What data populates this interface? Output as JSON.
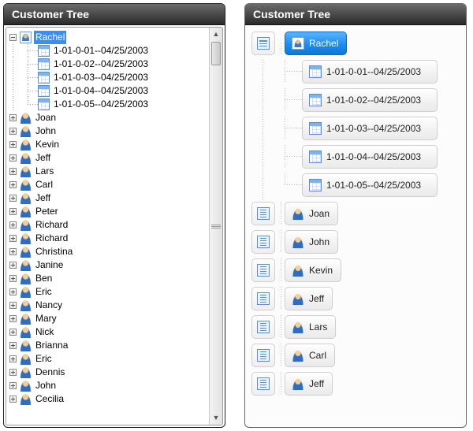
{
  "left": {
    "title": "Customer Tree",
    "root": {
      "label": "Rachel",
      "expanded": true,
      "selected": true,
      "icon": "org",
      "children": [
        {
          "label": "1-01-0-01--04/25/2003",
          "icon": "grid"
        },
        {
          "label": "1-01-0-02--04/25/2003",
          "icon": "grid"
        },
        {
          "label": "1-01-0-03--04/25/2003",
          "icon": "grid"
        },
        {
          "label": "1-01-0-04--04/25/2003",
          "icon": "grid"
        },
        {
          "label": "1-01-0-05--04/25/2003",
          "icon": "grid"
        }
      ]
    },
    "siblings": [
      "Joan",
      "John",
      "Kevin",
      "Jeff",
      "Lars",
      "Carl",
      "Jeff",
      "Peter",
      "Richard",
      "Richard",
      "Christina",
      "Janine",
      "Ben",
      "Eric",
      "Nancy",
      "Mary",
      "Nick",
      "Brianna",
      "Eric",
      "Dennis",
      "John",
      "Cecilia"
    ]
  },
  "right": {
    "title": "Customer Tree",
    "root": {
      "label": "Rachel",
      "expanded": true,
      "selected": true,
      "icon": "org",
      "children": [
        {
          "label": "1-01-0-01--04/25/2003",
          "icon": "grid"
        },
        {
          "label": "1-01-0-02--04/25/2003",
          "icon": "grid"
        },
        {
          "label": "1-01-0-03--04/25/2003",
          "icon": "grid"
        },
        {
          "label": "1-01-0-04--04/25/2003",
          "icon": "grid"
        },
        {
          "label": "1-01-0-05--04/25/2003",
          "icon": "grid"
        }
      ]
    },
    "siblings": [
      "Joan",
      "John",
      "Kevin",
      "Jeff",
      "Lars",
      "Carl",
      "Jeff"
    ]
  }
}
